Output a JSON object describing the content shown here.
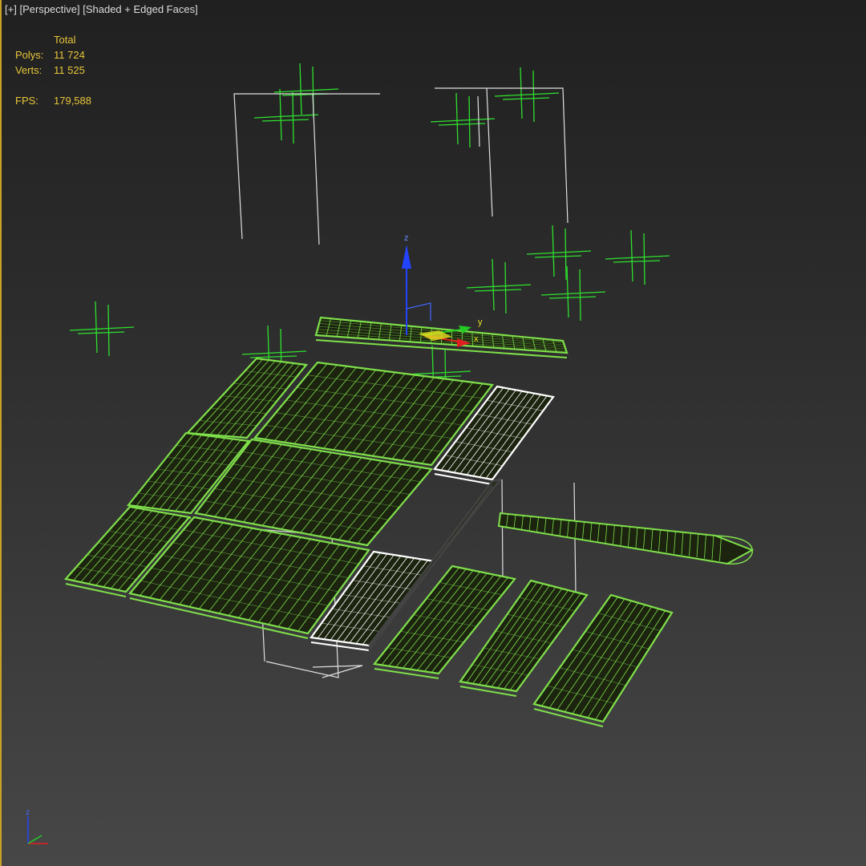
{
  "viewport": {
    "menu_label": "[+]",
    "view_label": "[Perspective]",
    "shading_label": "[Shaded + Edged Faces]"
  },
  "stats": {
    "header": "Total",
    "polys_label": "Polys:",
    "polys_value": "11 724",
    "verts_label": "Verts:",
    "verts_value": "11 525",
    "fps_label": "FPS:",
    "fps_value": "179,588"
  },
  "gizmo": {
    "z_label": "z",
    "y_label": "y",
    "x_label": "x"
  },
  "tripod": {
    "z_label": "z"
  },
  "colors": {
    "wire_green": "#7fe04a",
    "tile_fill": "#1c2410",
    "selected_wire": "#ffffff",
    "helper_green": "#2ee02e",
    "stats_text": "#e8c53a",
    "label_text": "#dcdcdc",
    "axis_blue": "#2244ff",
    "axis_red": "#e02020",
    "axis_green": "#22cc22",
    "border_yellow": "#c9a227"
  }
}
